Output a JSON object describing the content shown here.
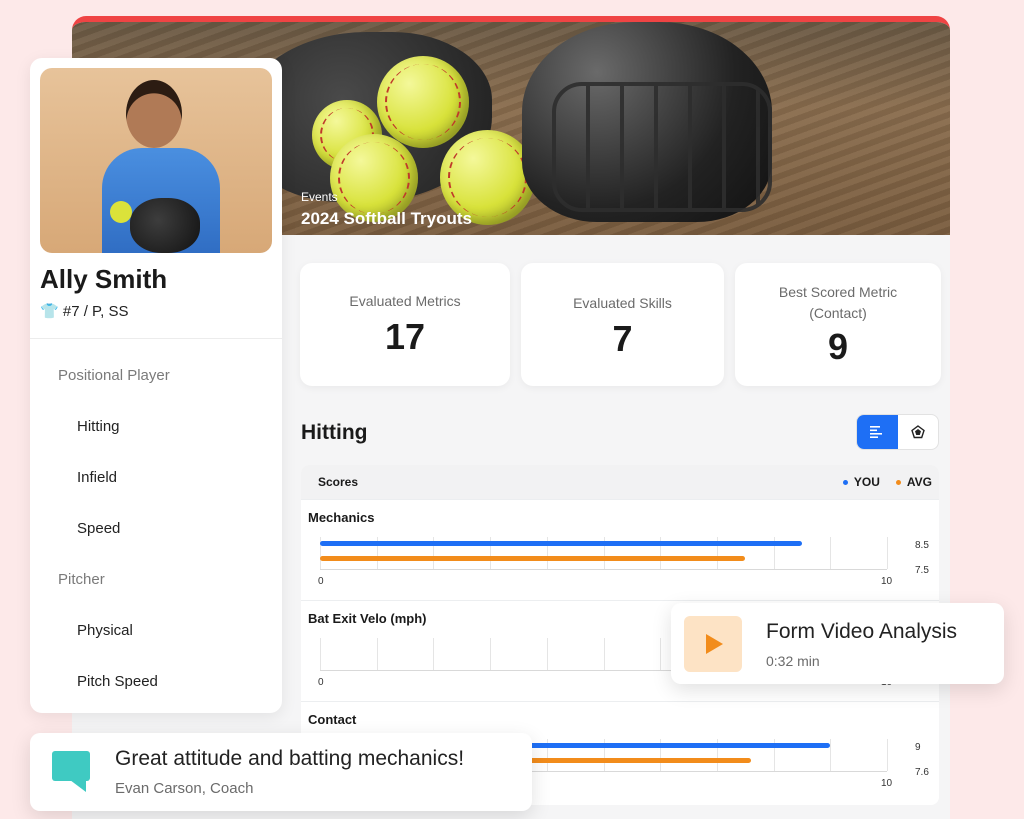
{
  "event": {
    "label": "Events",
    "title": "2024 Softball Tryouts"
  },
  "player": {
    "name": "Ally Smith",
    "meta": "#7 / P, SS",
    "jersey_icon": "jersey-icon"
  },
  "nav": {
    "groups": [
      {
        "label": "Positional Player",
        "items": [
          "Hitting",
          "Infield",
          "Speed"
        ]
      },
      {
        "label": "Pitcher",
        "items": [
          "Physical",
          "Pitch Speed"
        ]
      }
    ]
  },
  "stats": [
    {
      "label": "Evaluated Metrics",
      "value": "17"
    },
    {
      "label": "Evaluated Skills",
      "value": "7"
    },
    {
      "label": "Best Scored Metric",
      "sublabel": "(Contact)",
      "value": "9"
    }
  ],
  "section": {
    "title": "Hitting",
    "toggle": [
      "bar-list-icon",
      "radar-icon"
    ]
  },
  "scores": {
    "title": "Scores",
    "legend": {
      "you": "YOU",
      "avg": "AVG"
    },
    "colors": {
      "you": "#1e6ff5",
      "avg": "#f28c1b"
    }
  },
  "chart_data": {
    "type": "bar",
    "categories": [
      "Mechanics",
      "Bat Exit Velo (mph)",
      "Contact"
    ],
    "series": [
      {
        "name": "YOU",
        "values": [
          8.5,
          null,
          9
        ]
      },
      {
        "name": "AVG",
        "values": [
          7.5,
          null,
          7.6
        ]
      }
    ],
    "xlim": [
      0,
      10
    ],
    "tick_labels": [
      "0",
      "10"
    ],
    "value_labels": [
      [
        "8.5",
        "7.5"
      ],
      [
        "",
        ""
      ],
      [
        "9",
        "7.6"
      ]
    ]
  },
  "video": {
    "title": "Form Video Analysis",
    "duration": "0:32 min"
  },
  "comment": {
    "text": "Great attitude and batting mechanics!",
    "author": "Evan Carson, Coach"
  }
}
